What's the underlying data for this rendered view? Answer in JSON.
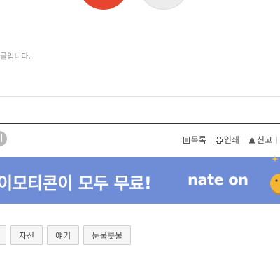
{
  "notice": {
    "text": "글입니다."
  },
  "toolbar": {
    "list_label": "목록",
    "print_label": "인쇄",
    "report_label": "신고"
  },
  "banner": {
    "text": "이모티콘이 모두 무료!",
    "logo": "nate on",
    "color": "#6f8dd6"
  },
  "tags": [
    {
      "label": ""
    },
    {
      "label": "자신"
    },
    {
      "label": "얘기"
    },
    {
      "label": "눈물콧물"
    }
  ],
  "colors": {
    "reaction_red": "#e8452f",
    "reaction_gray": "#ececec"
  }
}
